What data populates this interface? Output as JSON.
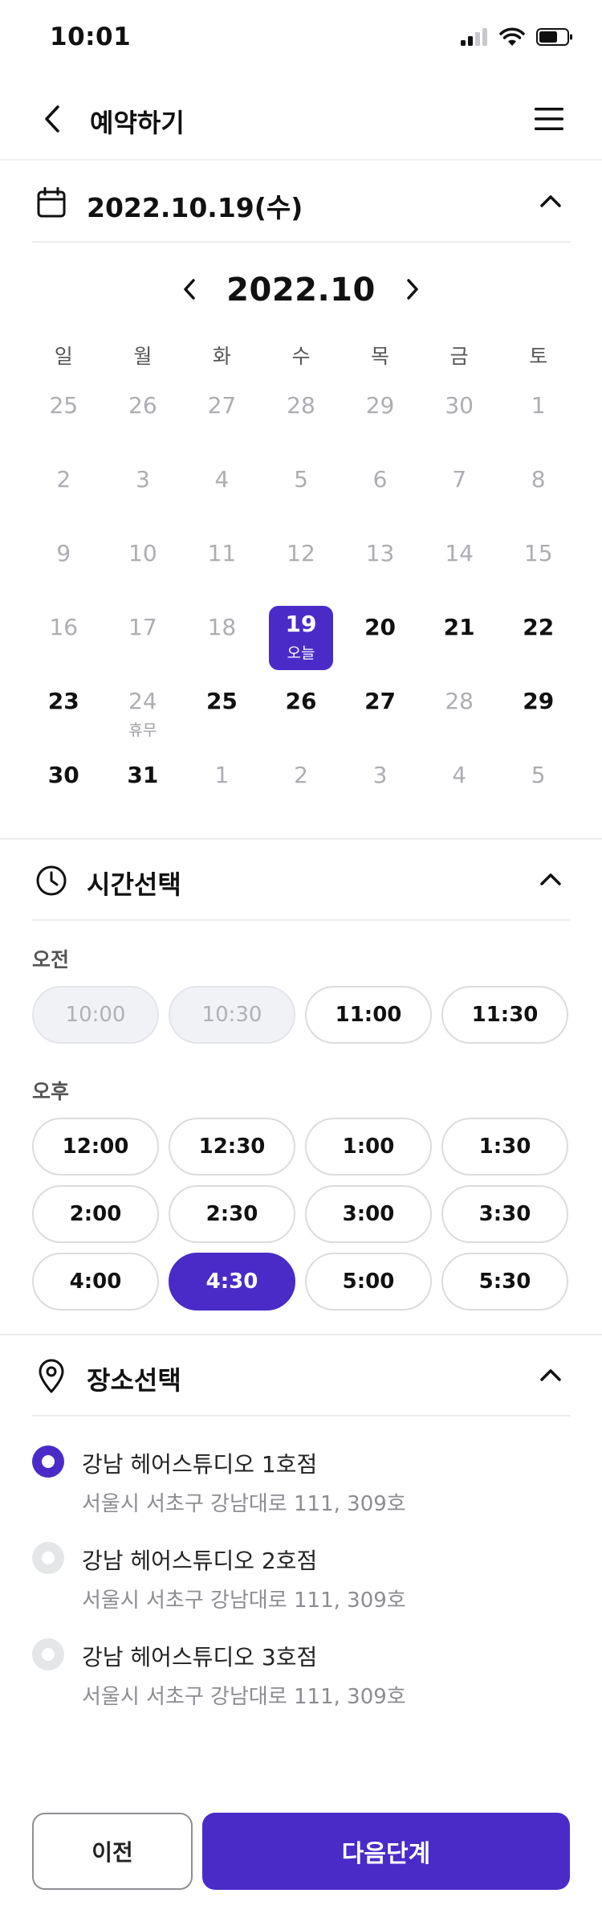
{
  "status_bar": {
    "time": "10:01",
    "icons": [
      "signal-icon",
      "wifi-icon",
      "battery-icon"
    ]
  },
  "header": {
    "back_icon": "chevron-left-icon",
    "title": "예약하기",
    "menu_icon": "hamburger-menu-icon"
  },
  "date_section": {
    "icon": "calendar-icon",
    "title": "2022.10.19(수)",
    "toggle_icon": "chevron-up-icon"
  },
  "calendar": {
    "month_label": "2022.10",
    "prev_icon": "chevron-left-icon",
    "next_icon": "chevron-right-icon",
    "weekdays": [
      "일",
      "월",
      "화",
      "수",
      "목",
      "금",
      "토"
    ],
    "days": [
      {
        "num": "25",
        "dim": true
      },
      {
        "num": "26",
        "dim": true
      },
      {
        "num": "27",
        "dim": true
      },
      {
        "num": "28",
        "dim": true
      },
      {
        "num": "29",
        "dim": true
      },
      {
        "num": "30",
        "dim": true
      },
      {
        "num": "1",
        "dim": true
      },
      {
        "num": "2",
        "dim": true
      },
      {
        "num": "3",
        "dim": true
      },
      {
        "num": "4",
        "dim": true
      },
      {
        "num": "5",
        "dim": true
      },
      {
        "num": "6",
        "dim": true
      },
      {
        "num": "7",
        "dim": true
      },
      {
        "num": "8",
        "dim": true
      },
      {
        "num": "9",
        "dim": true
      },
      {
        "num": "10",
        "dim": true
      },
      {
        "num": "11",
        "dim": true
      },
      {
        "num": "12",
        "dim": true
      },
      {
        "num": "13",
        "dim": true
      },
      {
        "num": "14",
        "dim": true
      },
      {
        "num": "15",
        "dim": true
      },
      {
        "num": "16",
        "dim": true
      },
      {
        "num": "17",
        "dim": true
      },
      {
        "num": "18",
        "dim": true
      },
      {
        "num": "19",
        "today": true,
        "sub": "오늘"
      },
      {
        "num": "20"
      },
      {
        "num": "21"
      },
      {
        "num": "22"
      },
      {
        "num": "23"
      },
      {
        "num": "24",
        "dim": true,
        "sub": "휴무"
      },
      {
        "num": "25"
      },
      {
        "num": "26"
      },
      {
        "num": "27"
      },
      {
        "num": "28",
        "dim": true
      },
      {
        "num": "29"
      },
      {
        "num": "30"
      },
      {
        "num": "31"
      },
      {
        "num": "1",
        "dim": true
      },
      {
        "num": "2",
        "dim": true
      },
      {
        "num": "3",
        "dim": true
      },
      {
        "num": "4",
        "dim": true
      },
      {
        "num": "5",
        "dim": true
      }
    ]
  },
  "time_section": {
    "icon": "clock-icon",
    "title": "시간선택",
    "toggle_icon": "chevron-up-icon",
    "am_label": "오전",
    "pm_label": "오후",
    "am_slots": [
      {
        "label": "10:00",
        "state": "disabled"
      },
      {
        "label": "10:30",
        "state": "disabled"
      },
      {
        "label": "11:00",
        "state": "available"
      },
      {
        "label": "11:30",
        "state": "available"
      }
    ],
    "pm_rows": [
      [
        {
          "label": "12:00",
          "state": "available"
        },
        {
          "label": "12:30",
          "state": "available"
        },
        {
          "label": "1:00",
          "state": "available"
        },
        {
          "label": "1:30",
          "state": "available"
        }
      ],
      [
        {
          "label": "2:00",
          "state": "available"
        },
        {
          "label": "2:30",
          "state": "available"
        },
        {
          "label": "3:00",
          "state": "available"
        },
        {
          "label": "3:30",
          "state": "available"
        }
      ],
      [
        {
          "label": "4:00",
          "state": "available"
        },
        {
          "label": "4:30",
          "state": "selected"
        },
        {
          "label": "5:00",
          "state": "available"
        },
        {
          "label": "5:30",
          "state": "available"
        }
      ]
    ]
  },
  "location_section": {
    "icon": "map-pin-icon",
    "title": "장소선택",
    "toggle_icon": "chevron-up-icon",
    "items": [
      {
        "name": "강남 헤어스튜디오 1호점",
        "address": "서울시 서초구 강남대로 111, 309호",
        "checked": true
      },
      {
        "name": "강남 헤어스튜디오 2호점",
        "address": "서울시 서초구 강남대로 111, 309호",
        "checked": false
      },
      {
        "name": "강남 헤어스튜디오 3호점",
        "address": "서울시 서초구 강남대로 111, 309호",
        "checked": false
      }
    ]
  },
  "footer": {
    "prev_label": "이전",
    "next_label": "다음단계"
  },
  "colors": {
    "accent": "#4a2bc8",
    "border": "#dcdce0",
    "dim_text": "#adadb3"
  }
}
